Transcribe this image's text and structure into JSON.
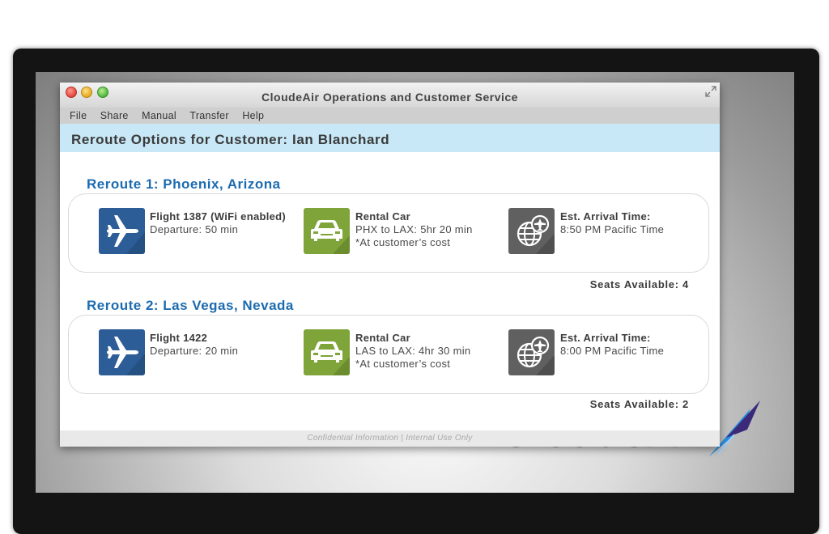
{
  "window": {
    "title": "CloudeAir Operations and Customer Service"
  },
  "menu": [
    "File",
    "Share",
    "Manual",
    "Transfer",
    "Help"
  ],
  "header": {
    "heading": "Reroute Options for Customer: Ian Blanchard"
  },
  "reroutes": [
    {
      "title": "Reroute 1: Phoenix, Arizona",
      "flight": {
        "title": "Flight 1387 (WiFi enabled)",
        "detail": "Departure: 50 min"
      },
      "car": {
        "title": "Rental Car",
        "detail": "PHX to LAX: 5hr 20 min",
        "note": "*At customer’s cost"
      },
      "arrival": {
        "title": "Est. Arrival Time:",
        "detail": "8:50 PM Pacific Time"
      },
      "seats": "Seats Available: 4"
    },
    {
      "title": "Reroute 2: Las Vegas, Nevada",
      "flight": {
        "title": "Flight 1422",
        "detail": "Departure: 20 min"
      },
      "car": {
        "title": "Rental Car",
        "detail": "LAS to LAX: 4hr 30 min",
        "note": "*At customer’s cost"
      },
      "arrival": {
        "title": "Est. Arrival Time:",
        "detail": "8:00 PM Pacific Time"
      },
      "seats": "Seats Available: 2"
    }
  ],
  "footer": "Confidential Information | Internal Use Only",
  "brand": {
    "prefix": "Cloude",
    "suffix": "Air"
  },
  "icons": {
    "flight": "airplane-icon",
    "car": "car-icon",
    "arrival": "globe-airplane-icon",
    "fullscreen": "expand-icon"
  },
  "colors": {
    "header_band": "#c8e8f7",
    "reroute_title": "#1c6bb0",
    "flight_tile": "#2d5d96",
    "car_tile": "#7ea43a",
    "arrival_tile": "#606060"
  }
}
